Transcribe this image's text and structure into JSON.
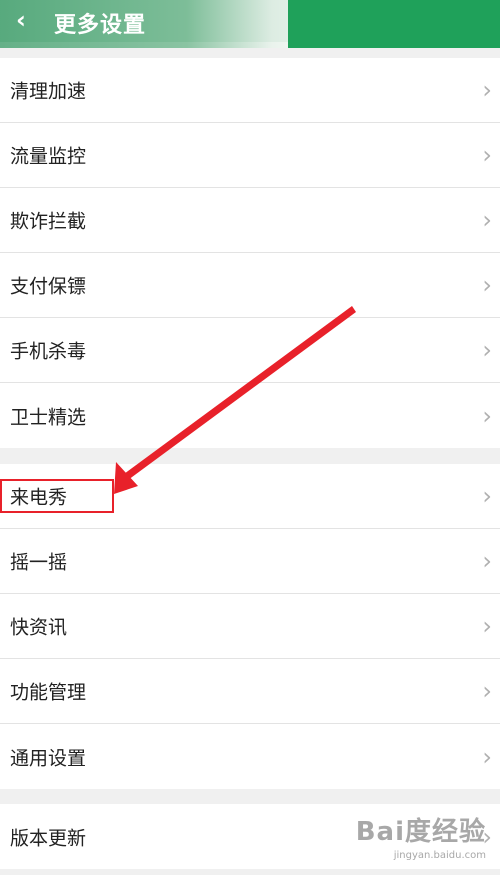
{
  "header": {
    "title": "更多设置",
    "back_icon": "chevron-left-icon",
    "colors": {
      "accent": "#1fa15a"
    }
  },
  "groups": [
    {
      "items": [
        {
          "label": "清理加速"
        },
        {
          "label": "流量监控"
        },
        {
          "label": "欺诈拦截"
        },
        {
          "label": "支付保镖"
        },
        {
          "label": "手机杀毒"
        },
        {
          "label": "卫士精选"
        }
      ]
    },
    {
      "items": [
        {
          "label": "来电秀",
          "highlighted": true
        },
        {
          "label": "摇一摇"
        },
        {
          "label": "快资讯"
        },
        {
          "label": "功能管理"
        },
        {
          "label": "通用设置"
        }
      ]
    },
    {
      "items": [
        {
          "label": "版本更新"
        }
      ]
    }
  ],
  "annotation": {
    "color": "#e8212a"
  },
  "watermark": {
    "main": "Bai度经验",
    "sub": "jingyan.baidu.com"
  }
}
